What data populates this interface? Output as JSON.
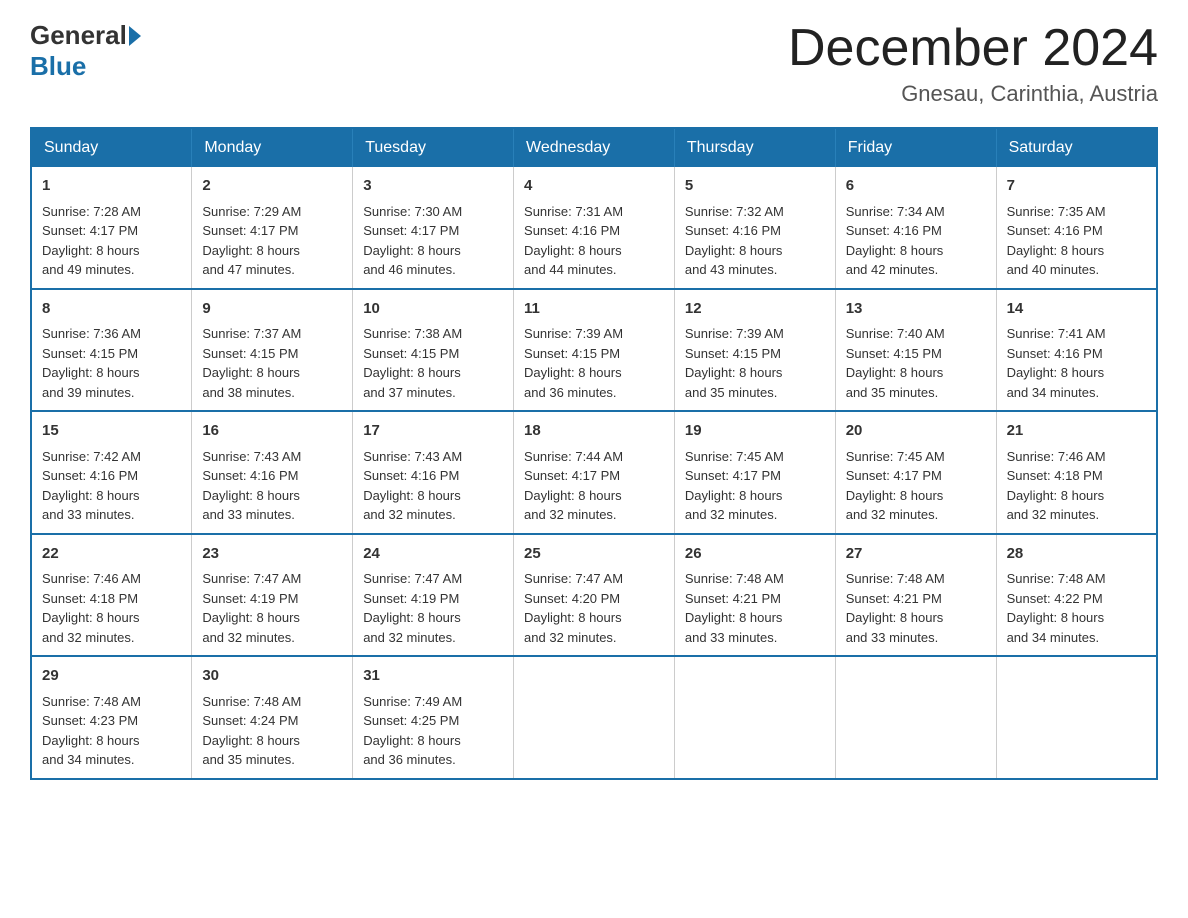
{
  "header": {
    "logo_general": "General",
    "logo_blue": "Blue",
    "month_title": "December 2024",
    "location": "Gnesau, Carinthia, Austria"
  },
  "weekdays": [
    "Sunday",
    "Monday",
    "Tuesday",
    "Wednesday",
    "Thursday",
    "Friday",
    "Saturday"
  ],
  "weeks": [
    [
      {
        "day": "1",
        "sunrise": "7:28 AM",
        "sunset": "4:17 PM",
        "daylight": "8 hours and 49 minutes."
      },
      {
        "day": "2",
        "sunrise": "7:29 AM",
        "sunset": "4:17 PM",
        "daylight": "8 hours and 47 minutes."
      },
      {
        "day": "3",
        "sunrise": "7:30 AM",
        "sunset": "4:17 PM",
        "daylight": "8 hours and 46 minutes."
      },
      {
        "day": "4",
        "sunrise": "7:31 AM",
        "sunset": "4:16 PM",
        "daylight": "8 hours and 44 minutes."
      },
      {
        "day": "5",
        "sunrise": "7:32 AM",
        "sunset": "4:16 PM",
        "daylight": "8 hours and 43 minutes."
      },
      {
        "day": "6",
        "sunrise": "7:34 AM",
        "sunset": "4:16 PM",
        "daylight": "8 hours and 42 minutes."
      },
      {
        "day": "7",
        "sunrise": "7:35 AM",
        "sunset": "4:16 PM",
        "daylight": "8 hours and 40 minutes."
      }
    ],
    [
      {
        "day": "8",
        "sunrise": "7:36 AM",
        "sunset": "4:15 PM",
        "daylight": "8 hours and 39 minutes."
      },
      {
        "day": "9",
        "sunrise": "7:37 AM",
        "sunset": "4:15 PM",
        "daylight": "8 hours and 38 minutes."
      },
      {
        "day": "10",
        "sunrise": "7:38 AM",
        "sunset": "4:15 PM",
        "daylight": "8 hours and 37 minutes."
      },
      {
        "day": "11",
        "sunrise": "7:39 AM",
        "sunset": "4:15 PM",
        "daylight": "8 hours and 36 minutes."
      },
      {
        "day": "12",
        "sunrise": "7:39 AM",
        "sunset": "4:15 PM",
        "daylight": "8 hours and 35 minutes."
      },
      {
        "day": "13",
        "sunrise": "7:40 AM",
        "sunset": "4:15 PM",
        "daylight": "8 hours and 35 minutes."
      },
      {
        "day": "14",
        "sunrise": "7:41 AM",
        "sunset": "4:16 PM",
        "daylight": "8 hours and 34 minutes."
      }
    ],
    [
      {
        "day": "15",
        "sunrise": "7:42 AM",
        "sunset": "4:16 PM",
        "daylight": "8 hours and 33 minutes."
      },
      {
        "day": "16",
        "sunrise": "7:43 AM",
        "sunset": "4:16 PM",
        "daylight": "8 hours and 33 minutes."
      },
      {
        "day": "17",
        "sunrise": "7:43 AM",
        "sunset": "4:16 PM",
        "daylight": "8 hours and 32 minutes."
      },
      {
        "day": "18",
        "sunrise": "7:44 AM",
        "sunset": "4:17 PM",
        "daylight": "8 hours and 32 minutes."
      },
      {
        "day": "19",
        "sunrise": "7:45 AM",
        "sunset": "4:17 PM",
        "daylight": "8 hours and 32 minutes."
      },
      {
        "day": "20",
        "sunrise": "7:45 AM",
        "sunset": "4:17 PM",
        "daylight": "8 hours and 32 minutes."
      },
      {
        "day": "21",
        "sunrise": "7:46 AM",
        "sunset": "4:18 PM",
        "daylight": "8 hours and 32 minutes."
      }
    ],
    [
      {
        "day": "22",
        "sunrise": "7:46 AM",
        "sunset": "4:18 PM",
        "daylight": "8 hours and 32 minutes."
      },
      {
        "day": "23",
        "sunrise": "7:47 AM",
        "sunset": "4:19 PM",
        "daylight": "8 hours and 32 minutes."
      },
      {
        "day": "24",
        "sunrise": "7:47 AM",
        "sunset": "4:19 PM",
        "daylight": "8 hours and 32 minutes."
      },
      {
        "day": "25",
        "sunrise": "7:47 AM",
        "sunset": "4:20 PM",
        "daylight": "8 hours and 32 minutes."
      },
      {
        "day": "26",
        "sunrise": "7:48 AM",
        "sunset": "4:21 PM",
        "daylight": "8 hours and 33 minutes."
      },
      {
        "day": "27",
        "sunrise": "7:48 AM",
        "sunset": "4:21 PM",
        "daylight": "8 hours and 33 minutes."
      },
      {
        "day": "28",
        "sunrise": "7:48 AM",
        "sunset": "4:22 PM",
        "daylight": "8 hours and 34 minutes."
      }
    ],
    [
      {
        "day": "29",
        "sunrise": "7:48 AM",
        "sunset": "4:23 PM",
        "daylight": "8 hours and 34 minutes."
      },
      {
        "day": "30",
        "sunrise": "7:48 AM",
        "sunset": "4:24 PM",
        "daylight": "8 hours and 35 minutes."
      },
      {
        "day": "31",
        "sunrise": "7:49 AM",
        "sunset": "4:25 PM",
        "daylight": "8 hours and 36 minutes."
      },
      null,
      null,
      null,
      null
    ]
  ]
}
